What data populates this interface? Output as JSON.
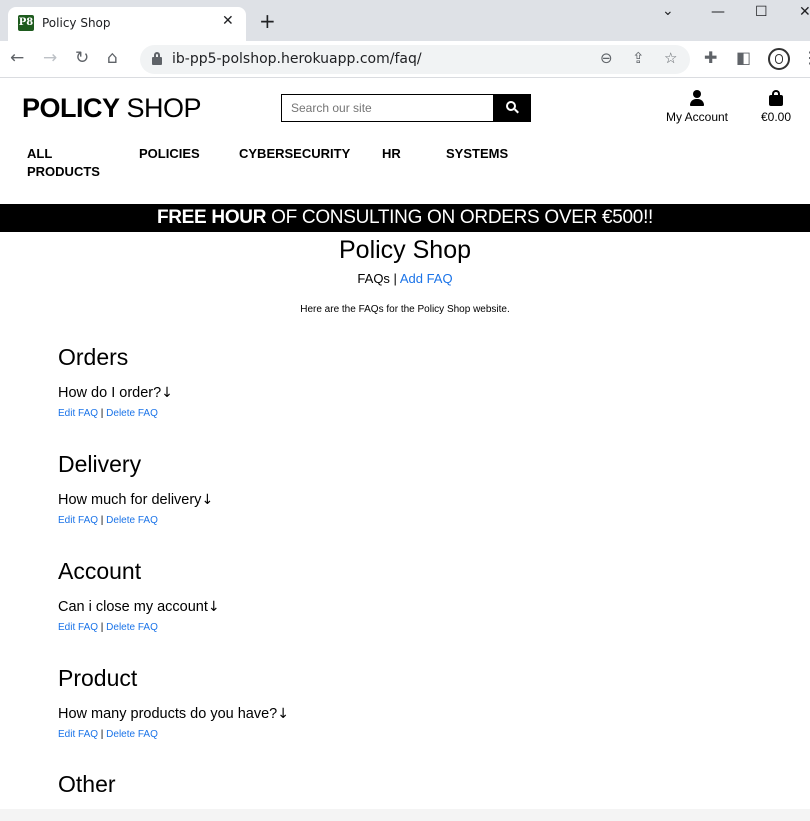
{
  "browser": {
    "tab_title": "Policy Shop",
    "favicon_text": "P8",
    "url": "ib-pp5-polshop.herokuapp.com/faq/"
  },
  "header": {
    "logo_bold": "POLICY",
    "logo_light": "SHOP",
    "search_placeholder": "Search our site",
    "account_label": "My Account",
    "bag_total": "€0.00"
  },
  "nav": {
    "items": [
      {
        "label": "ALL PRODUCTS"
      },
      {
        "label": "POLICIES"
      },
      {
        "label": "CYBERSECURITY"
      },
      {
        "label": "HR"
      },
      {
        "label": "SYSTEMS"
      }
    ]
  },
  "banner": {
    "bold": "FREE HOUR",
    "rest": " OF CONSULTING ON ORDERS OVER €500!!"
  },
  "page": {
    "title": "Policy Shop",
    "subnav_current": "FAQs",
    "subnav_separator": " | ",
    "subnav_link": "Add FAQ",
    "intro": "Here are the FAQs for the Policy Shop website."
  },
  "faqs": [
    {
      "category": "Orders",
      "question": "How do I order?",
      "edit": "Edit FAQ",
      "delete": "Delete FAQ"
    },
    {
      "category": "Delivery",
      "question": "How much for delivery",
      "edit": "Edit FAQ",
      "delete": "Delete FAQ"
    },
    {
      "category": "Account",
      "question": "Can i close my account",
      "edit": "Edit FAQ",
      "delete": "Delete FAQ"
    },
    {
      "category": "Product",
      "question": "How many products do you have?",
      "edit": "Edit FAQ",
      "delete": "Delete FAQ"
    },
    {
      "category": "Other"
    }
  ],
  "arrow_glyph": "↓",
  "action_separator": " | "
}
